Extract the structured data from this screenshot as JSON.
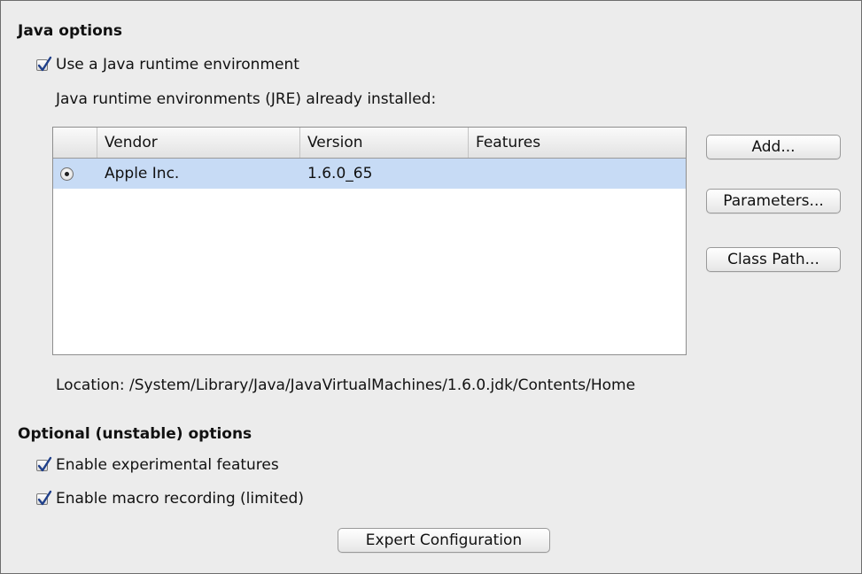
{
  "java_options": {
    "heading": "Java options",
    "use_jre_label": "Use a Java runtime environment",
    "use_jre_checked": true,
    "installed_label": "Java runtime environments (JRE) already installed:",
    "table": {
      "columns": [
        "Vendor",
        "Version",
        "Features"
      ],
      "rows": [
        {
          "selected": true,
          "vendor": "Apple Inc.",
          "version": "1.6.0_65",
          "features": ""
        }
      ]
    },
    "buttons": {
      "add": "Add...",
      "parameters": "Parameters...",
      "class_path": "Class Path..."
    },
    "location": "Location: /System/Library/Java/JavaVirtualMachines/1.6.0.jdk/Contents/Home"
  },
  "optional_options": {
    "heading": "Optional (unstable) options",
    "experimental_label": "Enable experimental features",
    "experimental_checked": true,
    "macro_label": "Enable macro recording (limited)",
    "macro_checked": true,
    "expert_button": "Expert Configuration"
  },
  "colors": {
    "background": "#ececec",
    "selection": "#c7dbf5",
    "check_accent": "#1f3f8a"
  }
}
